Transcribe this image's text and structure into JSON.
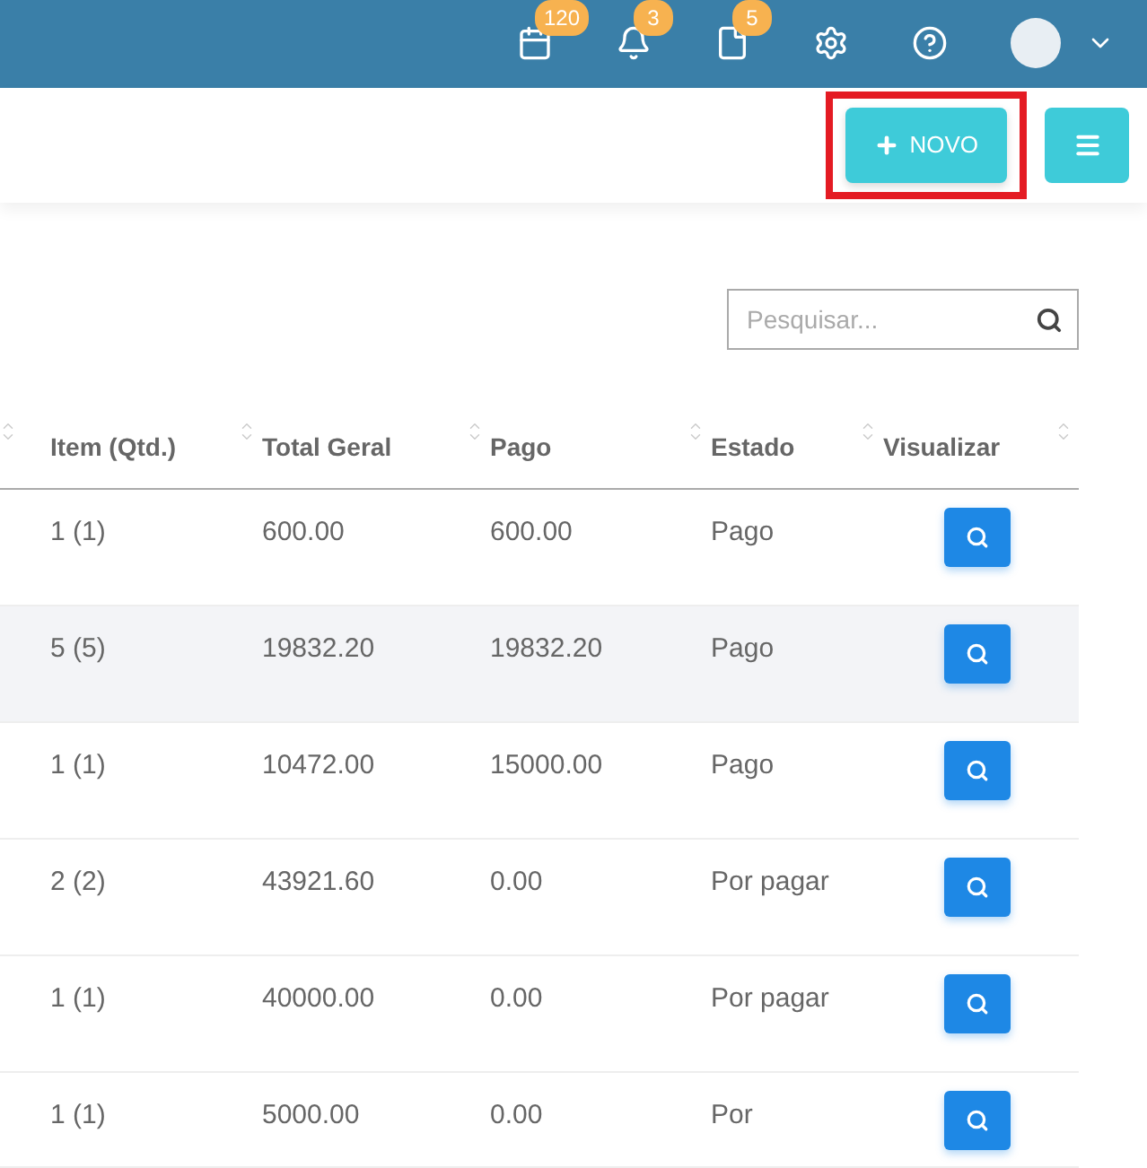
{
  "topbar": {
    "icons": [
      {
        "kind": "calendar",
        "badge": "120"
      },
      {
        "kind": "bell",
        "badge": "3"
      },
      {
        "kind": "file",
        "badge": "5"
      },
      {
        "kind": "gear"
      },
      {
        "kind": "help"
      }
    ]
  },
  "toolbar": {
    "new_button": {
      "label": "NOVO",
      "highlighted": true
    }
  },
  "search": {
    "placeholder": "Pesquisar..."
  },
  "table": {
    "columns": [
      "Item (Qtd.)",
      "Total Geral",
      "Pago",
      "Estado",
      "Visualizar"
    ],
    "rows": [
      {
        "cells": [
          "1 (1)",
          "600.00",
          "600.00",
          "Pago"
        ],
        "shaded": false
      },
      {
        "cells": [
          "5 (5)",
          "19832.20",
          "19832.20",
          "Pago"
        ],
        "shaded": true
      },
      {
        "cells": [
          "1 (1)",
          "10472.00",
          "15000.00",
          "Pago"
        ],
        "shaded": false
      },
      {
        "cells": [
          "2 (2)",
          "43921.60",
          "0.00",
          "Por pagar"
        ],
        "shaded": false
      },
      {
        "cells": [
          "1 (1)",
          "40000.00",
          "0.00",
          "Por pagar"
        ],
        "shaded": false
      },
      {
        "cells": [
          "1 (1)",
          "5000.00",
          "0.00",
          "Por"
        ],
        "shaded": false
      }
    ]
  }
}
